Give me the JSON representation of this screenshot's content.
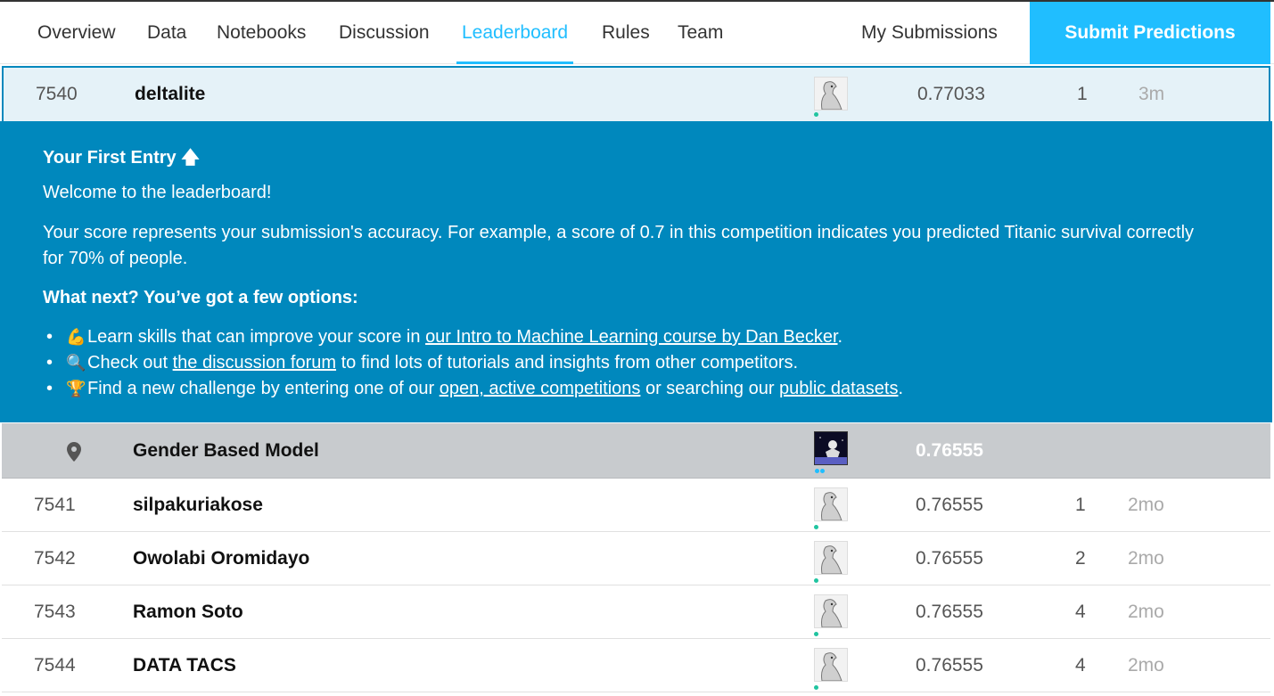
{
  "nav": {
    "tabs": [
      "Overview",
      "Data",
      "Notebooks",
      "Discussion",
      "Leaderboard",
      "Rules",
      "Team"
    ],
    "active_tab": "Leaderboard",
    "my_submissions": "My Submissions",
    "submit_label": "Submit Predictions",
    "accent_color": "#20beff"
  },
  "first_row": {
    "rank": "7540",
    "name": "deltalite",
    "score": "0.77033",
    "entries": "1",
    "last": "3m"
  },
  "panel": {
    "title": "Your First Entry",
    "welcome": "Welcome to the leaderboard!",
    "score_text": "Your score represents your submission's accuracy. For example, a score of 0.7 in this competition indicates you predicted Titanic survival correctly for 70% of people.",
    "next_title": "What next? You’ve got a few options:",
    "bullets": [
      {
        "icon": "💪",
        "pre": "Learn skills that can improve your score in ",
        "link": "our Intro to Machine Learning course by Dan Becker",
        "post": "."
      },
      {
        "icon": "🔍",
        "pre": "Check out ",
        "link": "the discussion forum",
        "post": " to find lots of tutorials and insights from other competitors."
      },
      {
        "icon": "🏆",
        "pre": "Find a new challenge by entering one of our ",
        "link": "open, active competitions",
        "mid": " or searching our ",
        "link2": "public datasets",
        "post": "."
      }
    ],
    "bg_color": "#0088bd"
  },
  "benchmark": {
    "name": "Gender Based Model",
    "score": "0.76555"
  },
  "rows": [
    {
      "rank": "7541",
      "name": "silpakuriakose",
      "score": "0.76555",
      "entries": "1",
      "last": "2mo"
    },
    {
      "rank": "7542",
      "name": "Owolabi Oromidayo",
      "score": "0.76555",
      "entries": "2",
      "last": "2mo"
    },
    {
      "rank": "7543",
      "name": "Ramon Soto",
      "score": "0.76555",
      "entries": "4",
      "last": "2mo"
    },
    {
      "rank": "7544",
      "name": "DATA TACS",
      "score": "0.76555",
      "entries": "4",
      "last": "2mo"
    }
  ]
}
